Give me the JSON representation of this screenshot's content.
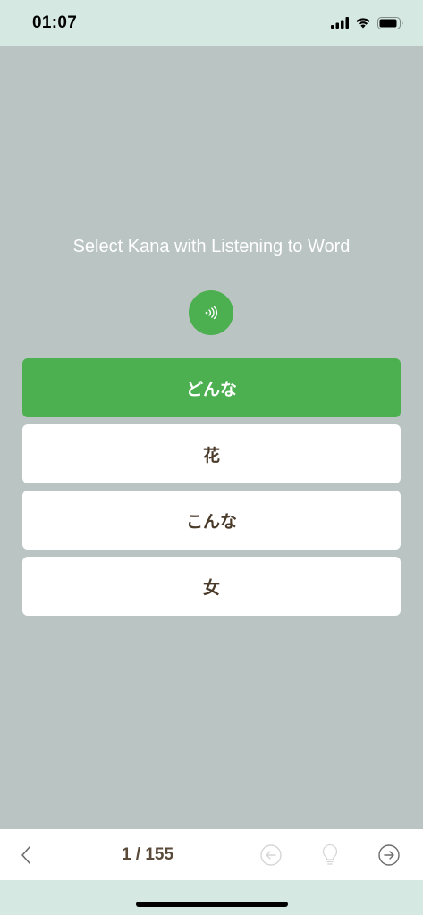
{
  "status_bar": {
    "time": "01:07",
    "icons": [
      "cellular-signal-icon",
      "wifi-icon",
      "battery-icon"
    ]
  },
  "quiz": {
    "prompt": "Select Kana with Listening to Word",
    "audio_icon": "speaker-sound-icon",
    "options": [
      {
        "label": "どんな",
        "selected": true
      },
      {
        "label": "花",
        "selected": false
      },
      {
        "label": "こんな",
        "selected": false
      },
      {
        "label": "女",
        "selected": false
      }
    ]
  },
  "bottom_bar": {
    "page_counter": "1 / 155",
    "icons": [
      "chevron-left-icon",
      "arrow-circle-left-icon",
      "lightbulb-icon",
      "arrow-circle-right-icon"
    ]
  },
  "colors": {
    "background": "#bac4c2",
    "accent_green": "#4caf50",
    "status_bar_bg": "#d5e8e2",
    "option_text": "#4a3a2a"
  }
}
